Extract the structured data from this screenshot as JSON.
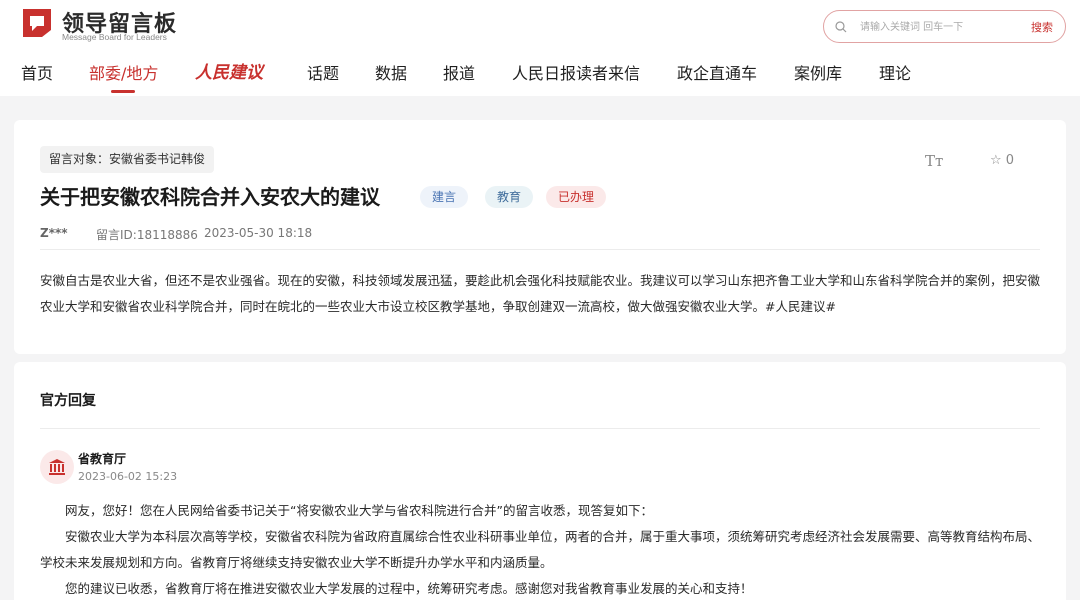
{
  "header": {
    "logo_title": "领导留言板",
    "logo_subtitle": "Message Board for Leaders",
    "search_placeholder": "请输入关键词 回车一下",
    "search_button": "搜索",
    "brand_color": "#c8312e"
  },
  "nav": {
    "items": [
      {
        "label": "首页"
      },
      {
        "label": "部委/地方",
        "active": true
      },
      {
        "label": "人民建议"
      },
      {
        "label": "话题"
      },
      {
        "label": "数据"
      },
      {
        "label": "报道"
      },
      {
        "label": "人民日报读者来信"
      },
      {
        "label": "政企直通车"
      },
      {
        "label": "案例库"
      },
      {
        "label": "理论"
      }
    ]
  },
  "message": {
    "target": "留言对象：安徽省委书记韩俊",
    "font_toggle": "Tт",
    "favorite_count": "0",
    "title": "关于把安徽农科院合并入安农大的建议",
    "tags": [
      "建言",
      "教育",
      "已办理"
    ],
    "author": "Z***",
    "message_id": "留言ID:18118886",
    "datetime": "2023-05-30 18:18",
    "body": "安徽自古是农业大省，但还不是农业强省。现在的安徽，科技领域发展迅猛，要趁此机会强化科技赋能农业。我建议可以学习山东把齐鲁工业大学和山东省科学院合并的案例，把安徽农业大学和安徽省农业科学院合并，同时在皖北的一些农业大市设立校区教学基地，争取创建双一流高校，做大做强安徽农业大学。#人民建议#"
  },
  "reply": {
    "heading": "官方回复",
    "department": "省教育厅",
    "datetime": "2023-06-02 15:23",
    "paragraphs": [
      "网友，您好！您在人民网给省委书记关于“将安徽农业大学与省农科院进行合并”的留言收悉，现答复如下：",
      "安徽农业大学为本科层次高等学校，安徽省农科院为省政府直属综合性农业科研事业单位，两者的合并，属于重大事项，须统筹研究考虑经济社会发展需要、高等教育结构布局、学校未来发展规划和方向。省教育厅将继续支持安徽农业大学不断提升办学水平和内涵质量。",
      "您的建议已收悉，省教育厅将在推进安徽农业大学发展的过程中，统筹研究考虑。感谢您对我省教育事业发展的关心和支持！"
    ]
  }
}
